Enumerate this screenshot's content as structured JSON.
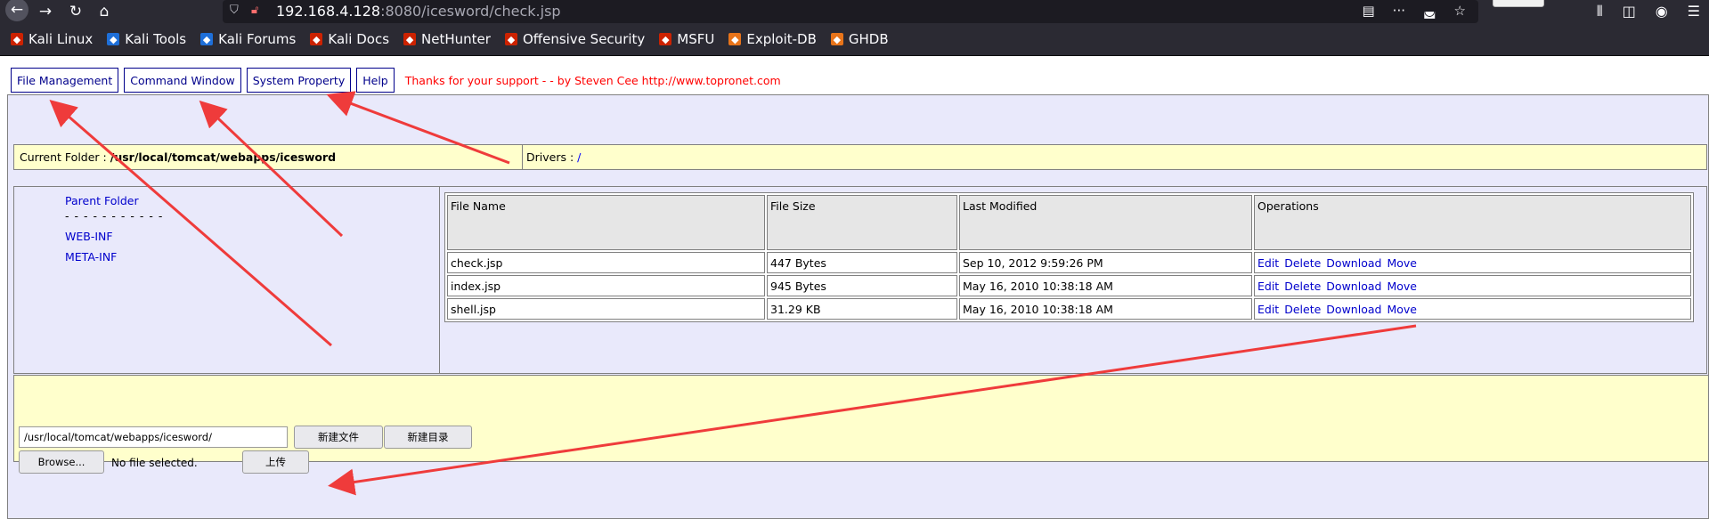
{
  "browser": {
    "url_host": "192.168.4.128",
    "url_rest": ":8080/icesword/check.jsp",
    "bookmarks": [
      {
        "label": "Kali Linux",
        "icon": "kali-icon",
        "color": "#cc2200"
      },
      {
        "label": "Kali Tools",
        "icon": "kali-tools-icon",
        "color": "#1e6fd9"
      },
      {
        "label": "Kali Forums",
        "icon": "kali-forums-icon",
        "color": "#1e6fd9"
      },
      {
        "label": "Kali Docs",
        "icon": "kali-docs-icon",
        "color": "#cc2200"
      },
      {
        "label": "NetHunter",
        "icon": "nethunter-icon",
        "color": "#cc2200"
      },
      {
        "label": "Offensive Security",
        "icon": "offsec-icon",
        "color": "#cc2200"
      },
      {
        "label": "MSFU",
        "icon": "msfu-icon",
        "color": "#cc2200"
      },
      {
        "label": "Exploit-DB",
        "icon": "exploitdb-icon",
        "color": "#e8741a"
      },
      {
        "label": "GHDB",
        "icon": "ghdb-icon",
        "color": "#e8741a"
      }
    ]
  },
  "tabs": {
    "file_management": "File Management",
    "command_window": "Command Window",
    "system_property": "System Property",
    "help": "Help",
    "thanks": "Thanks for your support - - by Steven Cee http://www.topronet.com"
  },
  "folder": {
    "current_label": "Current Folder :",
    "current_path": "/usr/local/tomcat/webapps/icesword",
    "drivers_label": "Drivers :",
    "drivers_value": "/"
  },
  "tree": {
    "parent": "Parent Folder",
    "separator": "- - - - - - - - - - -",
    "items": [
      "WEB-INF",
      "META-INF"
    ]
  },
  "files": {
    "headers": [
      "File Name",
      "File Size",
      "Last Modified",
      "Operations"
    ],
    "rows": [
      {
        "name": "check.jsp",
        "size": "447 Bytes",
        "modified": "Sep 10, 2012 9:59:26 PM"
      },
      {
        "name": "index.jsp",
        "size": "945 Bytes",
        "modified": "May 16, 2010 10:38:18 AM"
      },
      {
        "name": "shell.jsp",
        "size": "31.29 KB",
        "modified": "May 16, 2010 10:38:18 AM"
      }
    ],
    "operations": [
      "Edit",
      "Delete",
      "Download",
      "Move"
    ]
  },
  "upload": {
    "path_value": "/usr/local/tomcat/webapps/icesword/",
    "new_file": "新建文件",
    "new_dir": "新建目录",
    "browse": "Browse...",
    "no_file": "No file selected.",
    "upload": "上传"
  },
  "colors": {
    "annotation_arrow": "#ef3b3b",
    "panel_bg": "#e9e9fb",
    "folder_bg": "#ffffcc",
    "link": "#0000cc"
  }
}
